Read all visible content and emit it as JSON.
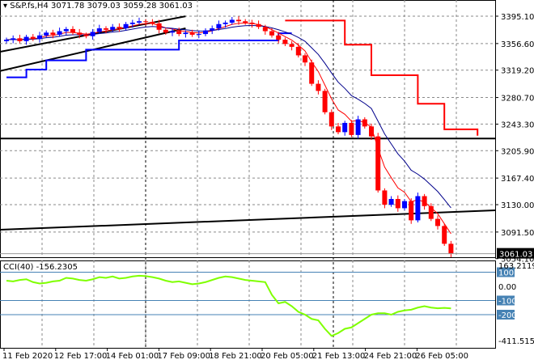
{
  "header": {
    "symbol": "S&P.fs,H4",
    "open": "3071.78",
    "high": "3079.03",
    "low": "3059.28",
    "close": "3061.03"
  },
  "chart_data": [
    {
      "type": "candlestick",
      "title": "S&P.fs,H4",
      "ylim": [
        3054.1,
        3420
      ],
      "y_ticks": [
        "3395.10",
        "3356.60",
        "3319.20",
        "3280.70",
        "3243.30",
        "3205.90",
        "3167.40",
        "3130.00",
        "3091.50",
        "3054.10"
      ],
      "last_price_label": "3061.03",
      "x_ticks": [
        "11 Feb 2020",
        "12 Feb 17:00",
        "14 Feb 01:00",
        "17 Feb 09:00",
        "18 Feb 21:00",
        "20 Feb 05:00",
        "21 Feb 13:00",
        "24 Feb 21:00",
        "26 Feb 05:00"
      ],
      "first_open": 3360,
      "closes": [
        3362,
        3364,
        3360,
        3366,
        3363,
        3368,
        3372,
        3369,
        3374,
        3377,
        3372,
        3369,
        3367,
        3373,
        3378,
        3376,
        3380,
        3378,
        3384,
        3386,
        3388,
        3387,
        3385,
        3376,
        3372,
        3374,
        3370,
        3372,
        3369,
        3370,
        3375,
        3378,
        3384,
        3386,
        3390,
        3388,
        3386,
        3384,
        3380,
        3374,
        3368,
        3362,
        3356,
        3352,
        3340,
        3330,
        3300,
        3290,
        3260,
        3240,
        3232,
        3245,
        3228,
        3250,
        3240,
        3226,
        3150,
        3130,
        3138,
        3125,
        3135,
        3108,
        3142,
        3128,
        3110,
        3100,
        3075,
        3061
      ],
      "upper_step": [
        [
          42,
          3389
        ],
        [
          51,
          3355
        ],
        [
          55,
          3312
        ],
        [
          62,
          3272
        ],
        [
          66,
          3236
        ],
        [
          70,
          3236
        ],
        [
          71,
          3227
        ]
      ],
      "lower_step": [
        [
          0,
          3309
        ],
        [
          3,
          3320
        ],
        [
          6,
          3333
        ],
        [
          12,
          3348
        ],
        [
          26,
          3361
        ],
        [
          41,
          3371
        ],
        [
          43,
          3371
        ]
      ],
      "trendlines": [
        {
          "name": "channel-upper",
          "from": [
            0,
            3345
          ],
          "to": [
            27,
            3395
          ]
        },
        {
          "name": "channel-lower",
          "from": [
            0,
            3318
          ],
          "to": [
            27,
            3378
          ]
        },
        {
          "name": "horizontal-support",
          "from": [
            0,
            3223
          ],
          "to": [
            76,
            3223
          ]
        },
        {
          "name": "rising-support",
          "from": [
            0,
            3094.7
          ],
          "to": [
            76,
            3122
          ]
        }
      ],
      "colors": {
        "bull": "#0000ff",
        "bear": "#ff0000",
        "fast_ma": "#ff0000",
        "slow_ma": "#00008b",
        "step_upper": "#ff0000",
        "step_lower": "#0000ff"
      }
    },
    {
      "type": "line",
      "title": "CCI(40) -156.2305",
      "ylim": [
        -411.5156,
        163.2119
      ],
      "y_ticks": [
        "163.2119",
        "100",
        "0.00",
        "-100",
        "-200",
        "-411.5156"
      ],
      "levels": [
        100,
        -100,
        -200
      ],
      "values": [
        40,
        35,
        45,
        50,
        30,
        20,
        25,
        35,
        40,
        60,
        55,
        45,
        40,
        50,
        65,
        60,
        70,
        55,
        60,
        70,
        75,
        72,
        65,
        55,
        40,
        30,
        35,
        25,
        15,
        20,
        30,
        45,
        60,
        70,
        65,
        55,
        45,
        40,
        35,
        30,
        -60,
        -120,
        -110,
        -140,
        -180,
        -200,
        -230,
        -240,
        -300,
        -350,
        -330,
        -300,
        -290,
        -260,
        -230,
        -200,
        -190,
        -190,
        -200,
        -180,
        -170,
        -165,
        -150,
        -140,
        -150,
        -155,
        -152,
        -156
      ],
      "color": "#7fff00"
    }
  ]
}
